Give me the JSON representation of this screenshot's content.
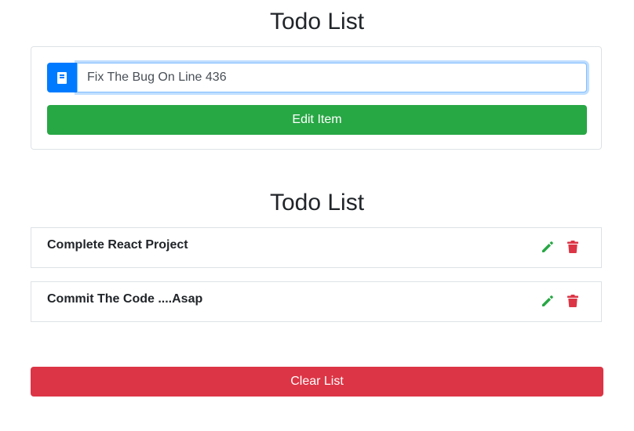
{
  "header": {
    "title": "Todo List"
  },
  "form": {
    "input_value": "Fix The Bug On Line 436",
    "input_icon": "book-icon",
    "submit_label": "Edit Item"
  },
  "list": {
    "title": "Todo List",
    "items": [
      {
        "label": "Complete React Project",
        "edit_icon": "pencil-icon",
        "delete_icon": "trash-icon"
      },
      {
        "label": "Commit The Code ....Asap",
        "edit_icon": "pencil-icon",
        "delete_icon": "trash-icon"
      }
    ],
    "clear_label": "Clear List"
  },
  "colors": {
    "primary": "#007bff",
    "success": "#28a745",
    "danger": "#dc3545"
  }
}
